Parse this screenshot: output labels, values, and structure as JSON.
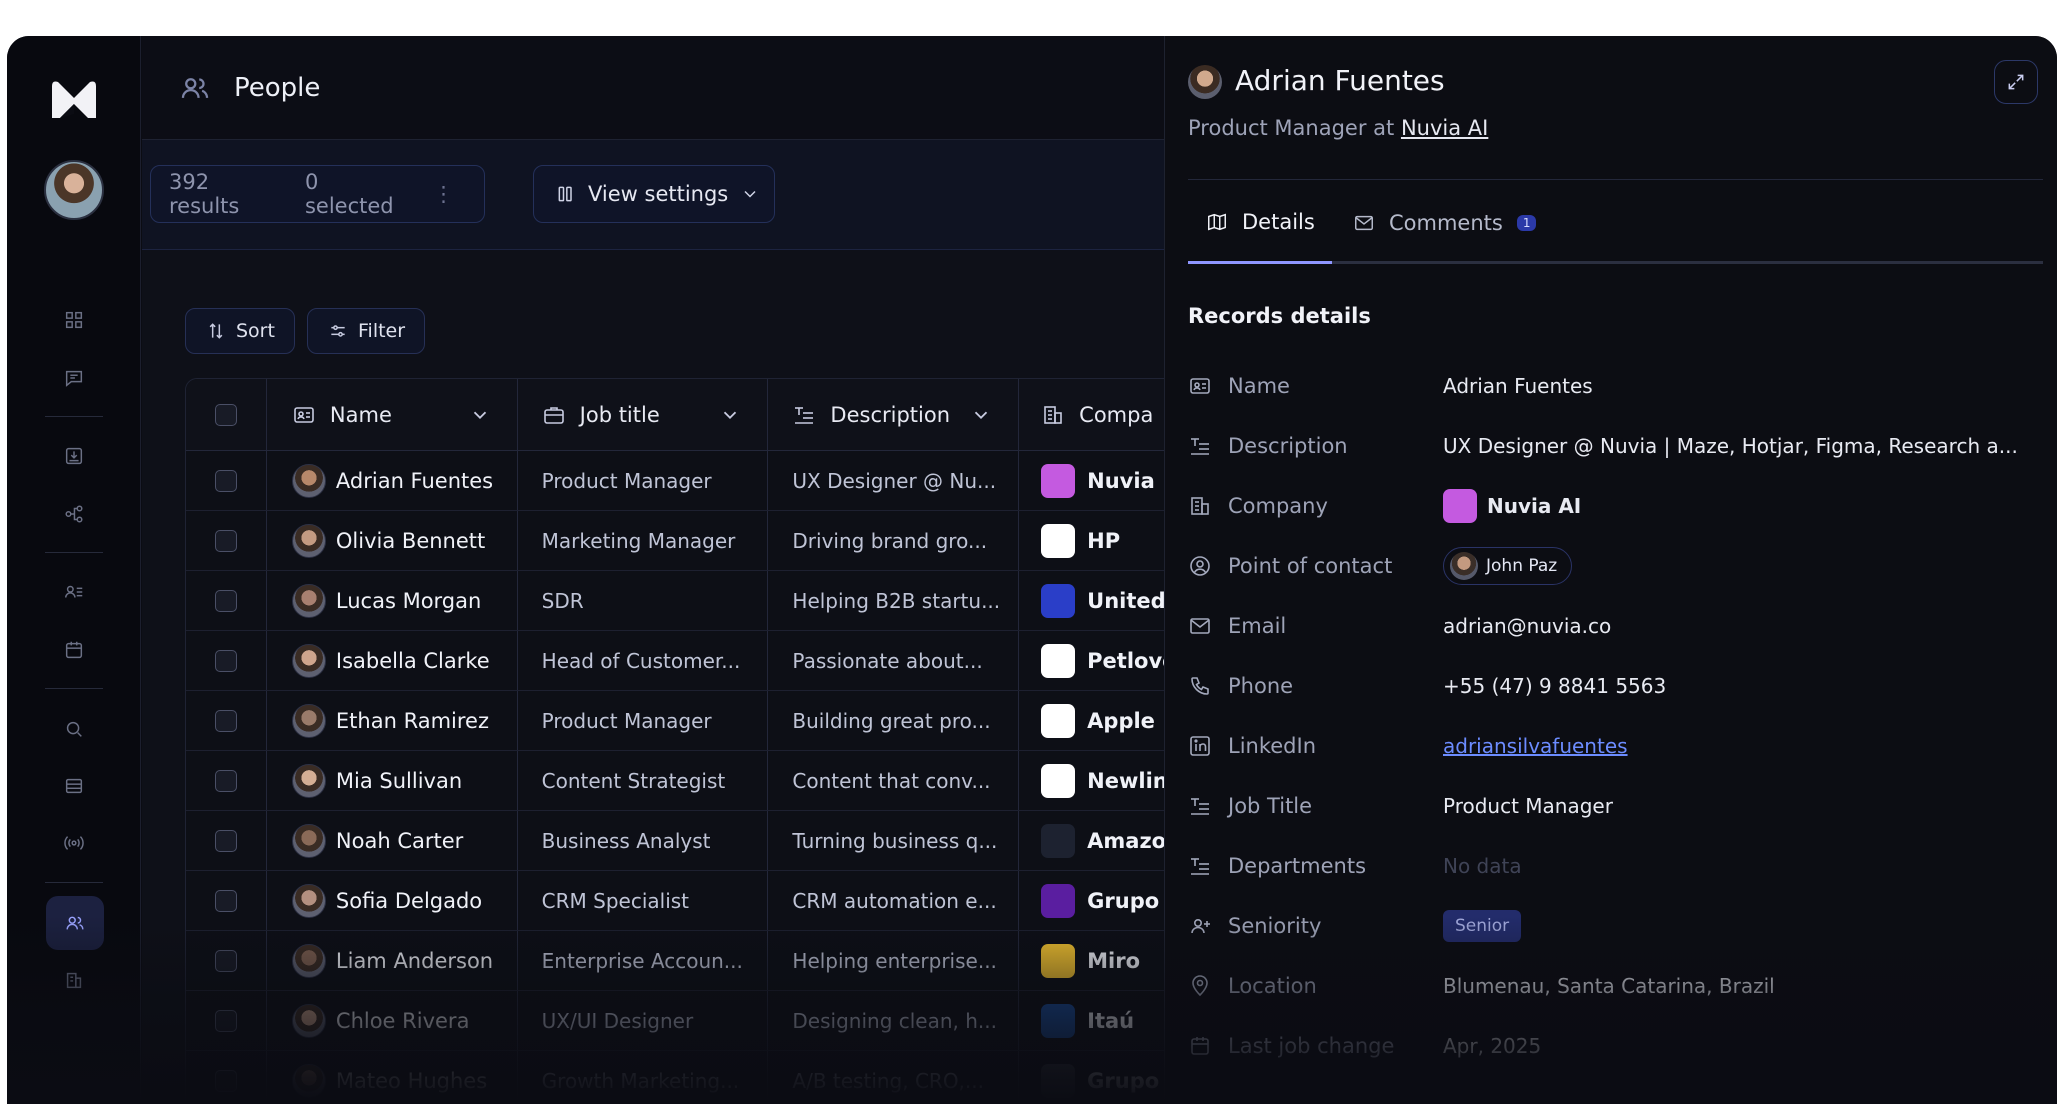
{
  "page": {
    "title": "People"
  },
  "toolbar": {
    "results": "392 results",
    "selected": "0 selected",
    "view_settings": "View settings",
    "sort": "Sort",
    "filter": "Filter"
  },
  "table": {
    "columns": [
      "Name",
      "Job title",
      "Description",
      "Compa"
    ],
    "rows": [
      {
        "name": "Adrian Fuentes",
        "job": "Product Manager",
        "desc": "UX Designer @ Nu...",
        "company": "Nuvia",
        "logo_color": "#c45ae0"
      },
      {
        "name": "Olivia Bennett",
        "job": "Marketing Manager",
        "desc": "Driving brand gro...",
        "company": "HP",
        "logo_color": "#ffffff"
      },
      {
        "name": "Lucas Morgan",
        "job": "SDR",
        "desc": "Helping B2B startu...",
        "company": "United",
        "logo_color": "#2a3ec8"
      },
      {
        "name": "Isabella Clarke",
        "job": "Head of Customer...",
        "desc": "Passionate about...",
        "company": "Petlove",
        "logo_color": "#ffffff"
      },
      {
        "name": "Ethan Ramirez",
        "job": "Product Manager",
        "desc": "Building great pro...",
        "company": "Apple",
        "logo_color": "#ffffff"
      },
      {
        "name": "Mia Sullivan",
        "job": "Content Strategist",
        "desc": "Content that conv...",
        "company": "Newlin",
        "logo_color": "#ffffff"
      },
      {
        "name": "Noah Carter",
        "job": "Business Analyst",
        "desc": "Turning business q...",
        "company": "Amazo",
        "logo_color": "#1d2230"
      },
      {
        "name": "Sofia Delgado",
        "job": "CRM Specialist",
        "desc": "CRM automation e...",
        "company": "Grupo",
        "logo_color": "#5a1ea0"
      },
      {
        "name": "Liam Anderson",
        "job": "Enterprise Accoun...",
        "desc": "Helping enterprise...",
        "company": "Miro",
        "logo_color": "#f2c230"
      },
      {
        "name": "Chloe Rivera",
        "job": "UX/UI Designer",
        "desc": "Designing clean, h...",
        "company": "Itaú",
        "logo_color": "#1a4e9e"
      },
      {
        "name": "Mateo Hughes",
        "job": "Growth Marketing...",
        "desc": "A/B testing, CRO,...",
        "company": "Grupo",
        "logo_color": "#3a3d48"
      }
    ]
  },
  "panel": {
    "name": "Adrian Fuentes",
    "role": "Product Manager",
    "at": "at",
    "company_link": "Nuvia AI",
    "tabs": {
      "details": "Details",
      "comments": "Comments",
      "comments_count": "1"
    },
    "section_title": "Records details",
    "fields": [
      {
        "label": "Name",
        "value": "Adrian Fuentes",
        "icon": "id-card-icon"
      },
      {
        "label": "Description",
        "value": "UX Designer @ Nuvia | Maze, Hotjar, Figma, Research a...",
        "icon": "text-lines-icon"
      },
      {
        "label": "Company",
        "value": "Nuvia AI",
        "icon": "building-icon"
      },
      {
        "label": "Point of contact",
        "value": "John Paz",
        "icon": "user-circle-icon"
      },
      {
        "label": "Email",
        "value": "adrian@nuvia.co",
        "icon": "mail-icon"
      },
      {
        "label": "Phone",
        "value": "+55 (47) 9 8841 5563",
        "icon": "phone-icon"
      },
      {
        "label": "LinkedIn",
        "value": "adriansilvafuentes",
        "icon": "linkedin-icon"
      },
      {
        "label": "Job Title",
        "value": "Product Manager",
        "icon": "text-lines-icon"
      },
      {
        "label": "Departments",
        "value": "No data",
        "icon": "text-lines-icon"
      },
      {
        "label": "Seniority",
        "value": "Senior",
        "icon": "user-plus-icon"
      },
      {
        "label": "Location",
        "value": "Blumenau, Santa Catarina, Brazil",
        "icon": "pin-icon"
      },
      {
        "label": "Last job change",
        "value": "Apr, 2025",
        "icon": "calendar-icon"
      }
    ]
  },
  "colors": {
    "accent": "#8f96ff",
    "link": "#6c8cff",
    "background": "#0b0c13"
  }
}
